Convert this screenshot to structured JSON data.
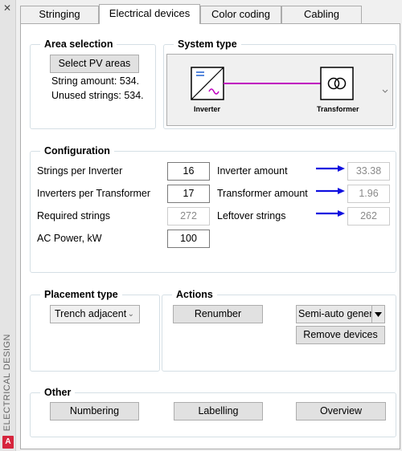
{
  "window": {
    "side_title": "ELECTRICAL DESIGN",
    "close_glyph": "✕",
    "app_icon_letter": "A"
  },
  "tabs": [
    {
      "label": "Stringing",
      "active": false
    },
    {
      "label": "Electrical devices",
      "active": true
    },
    {
      "label": "Color coding",
      "active": false
    },
    {
      "label": "Cabling",
      "active": false
    }
  ],
  "area_selection": {
    "title": "Area selection",
    "button": "Select PV areas",
    "string_amount": "String amount: 534.",
    "unused_strings": "Unused strings: 534."
  },
  "system_type": {
    "title": "System type",
    "inverter_label": "Inverter",
    "transformer_label": "Transformer",
    "line_color": "#c000c0",
    "dropdown_icon": "chevron-down-icon"
  },
  "configuration": {
    "title": "Configuration",
    "strings_per_inverter": {
      "label": "Strings per Inverter",
      "value": "16"
    },
    "inverters_per_transformer": {
      "label": "Inverters per Transformer",
      "value": "17"
    },
    "required_strings": {
      "label": "Required strings",
      "value": "272"
    },
    "ac_power": {
      "label": "AC Power, kW",
      "value": "100"
    },
    "inverter_amount": {
      "label": "Inverter amount",
      "value": "33.38"
    },
    "transformer_amount": {
      "label": "Transformer amount",
      "value": "1.96"
    },
    "leftover_strings": {
      "label": "Leftover strings",
      "value": "262"
    },
    "arrow_color": "#1010e0"
  },
  "placement_type": {
    "title": "Placement type",
    "selected": "Trench adjacent"
  },
  "actions": {
    "title": "Actions",
    "renumber": "Renumber",
    "semi_auto": "Semi-auto gener",
    "remove_devices": "Remove devices"
  },
  "other": {
    "title": "Other",
    "numbering": "Numbering",
    "labelling": "Labelling",
    "overview": "Overview"
  }
}
